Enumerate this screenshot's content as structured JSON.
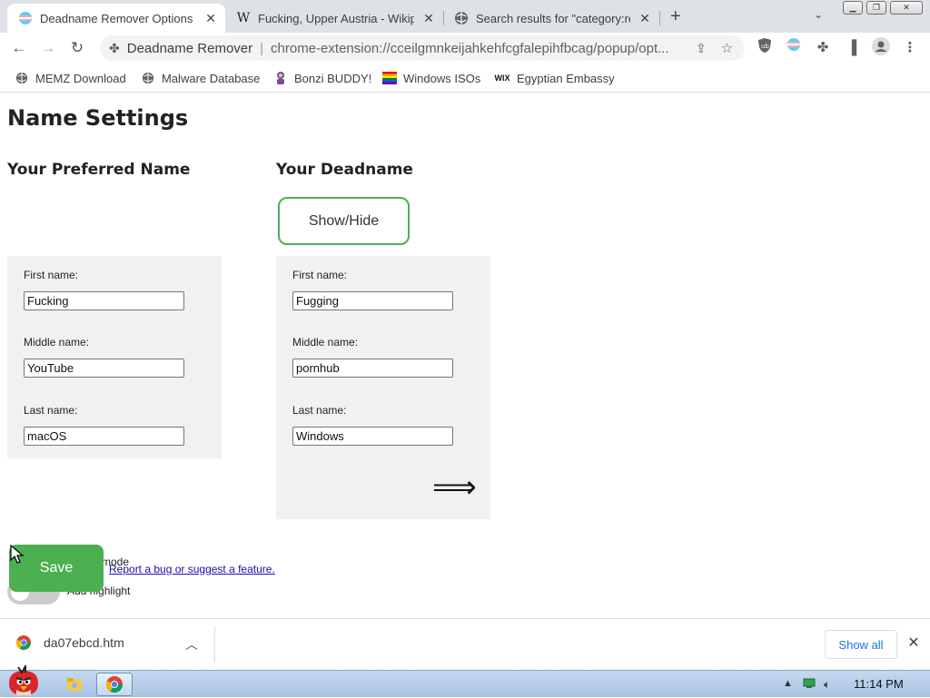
{
  "tabs": [
    {
      "title": "Deadname Remover Options",
      "icon": "transgender-flag-icon",
      "active": true
    },
    {
      "title": "Fucking, Upper Austria - Wikip",
      "icon": "wikipedia-icon",
      "active": false
    },
    {
      "title": "Search results for \"category:re",
      "icon": "globe-icon",
      "active": false
    }
  ],
  "toolbar": {
    "omnibox_name": "Deadname Remover",
    "omnibox_divider": "|",
    "omnibox_url": "chrome-extension://cceilgmnkeijahkehfcgfalepihfbcag/popup/opt..."
  },
  "bookmarks": [
    {
      "label": "MEMZ Download",
      "icon": "globe-icon"
    },
    {
      "label": "Malware Database",
      "icon": "globe-icon"
    },
    {
      "label": "Bonzi BUDDY!",
      "icon": "bonzi-icon"
    },
    {
      "label": "Windows ISOs",
      "icon": "rainbow-flag-icon"
    },
    {
      "label": "Egyptian Embassy",
      "icon": "wix-icon"
    }
  ],
  "page": {
    "title": "Name Settings",
    "preferred_heading": "Your Preferred Name",
    "deadname_heading": "Your Deadname",
    "show_hide_label": "Show/Hide",
    "labels": {
      "first": "First name:",
      "middle": "Middle name:",
      "last": "Last name:"
    },
    "preferred": {
      "first": "Fucking",
      "middle": "YouTube",
      "last": "macOS"
    },
    "deadname": {
      "first": "Fugging",
      "middle": "pornhub",
      "last": "Windows"
    },
    "arrow": "⟹",
    "save_label": "Save",
    "mode_label": "mode",
    "highlight_label": "Add highlight",
    "bug_link": "Report a bug or suggest a feature."
  },
  "downloads": {
    "file": "da07ebcd.htm",
    "show_all": "Show all"
  },
  "taskbar": {
    "clock": "11:14 PM"
  },
  "colors": {
    "accent_green": "#4caf50",
    "panel_bg": "#f1f1f1",
    "taskbar_top": "#c5d9f0"
  }
}
